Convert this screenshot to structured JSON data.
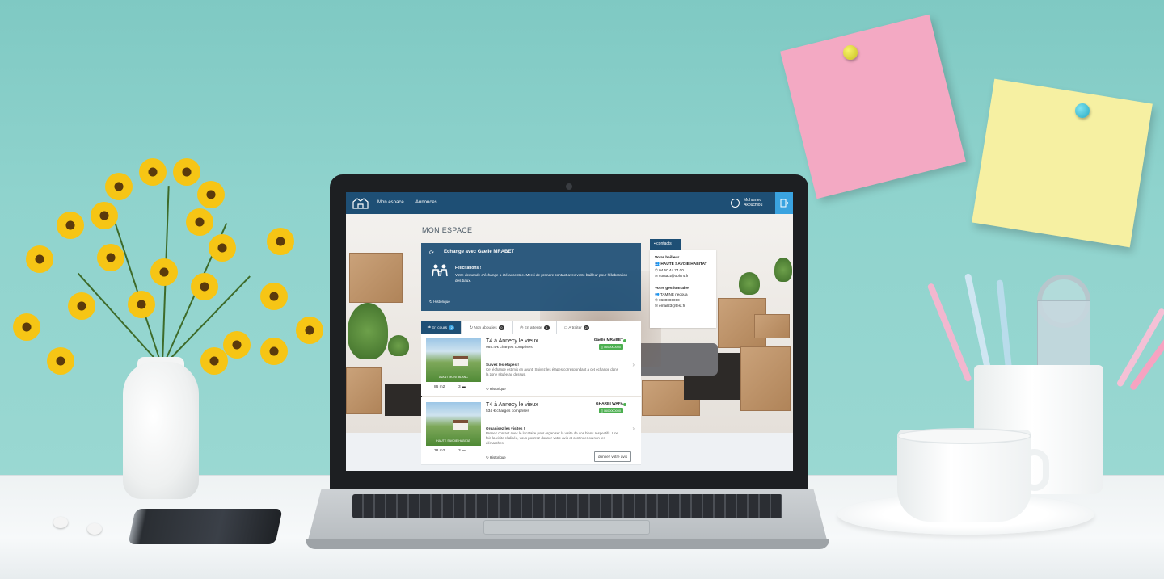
{
  "app": {
    "nav": [
      "Mon espace",
      "Annonces"
    ],
    "user": {
      "first_name": "Mohamed",
      "last_name": "Akouchiou"
    }
  },
  "page": {
    "title": "MON ESPACE"
  },
  "exchange": {
    "title": "Echange avec Gaelle MRABET",
    "congrats": "Félicitations !",
    "message": "Votre demande d'échange a été acceptée. Merci de prendre contact avec votre bailleur pour l'élaboration des baux.",
    "history": "Historique"
  },
  "contacts": {
    "tab_label": "contacts",
    "bailleur_heading": "Votre bailleur",
    "bailleur_name": "HAUTE SAVOIE HABITAT",
    "bailleur_phone": "04 50 44 74 00",
    "bailleur_email": "contact@oph74.fr",
    "gestionnaire_heading": "Votre gestionnaire",
    "gestionnaire_name": "TAMINE nedoua",
    "gestionnaire_phone": "0600000000",
    "gestionnaire_email": "email23@test.fr"
  },
  "tabs": [
    {
      "label": "En cours",
      "count": "2"
    },
    {
      "label": "Non abouties",
      "count": "0"
    },
    {
      "label": "En attente",
      "count": "1"
    },
    {
      "label": "A traiter",
      "count": "24"
    }
  ],
  "listings": [
    {
      "image_caption": "AVANT MONT BLANC",
      "title": "T4 à Annecy le vieux",
      "price": "985.4 € charges comprises",
      "owner": "Gaelle MRABET",
      "phone": "0600000000",
      "step_title": "Suivez les étapes !",
      "step_desc": "Cet échange est mis en avant. Suivez les étapes correspondant à cet échange dans la zone située au dessus.",
      "history": "Historique",
      "area": "86 m2",
      "rooms": "3"
    },
    {
      "image_caption": "HAUTE SAVOIE HABITAT",
      "title": "T4 à Annecy le vieux",
      "price": "534 € charges comprises",
      "owner": "GHARBI WAFA",
      "phone": "0600000000",
      "step_title": "Organisez les visites !",
      "step_desc": "Prenez contact avec le locataire pour organiser la visite de vos biens respectifs. Une fois la visite réalisée, vous pourrez donner votre avis et continuer ou non les démarches.",
      "history": "Historique",
      "area": "78 m2",
      "rooms": "3",
      "action": "donnez votre avis"
    }
  ]
}
